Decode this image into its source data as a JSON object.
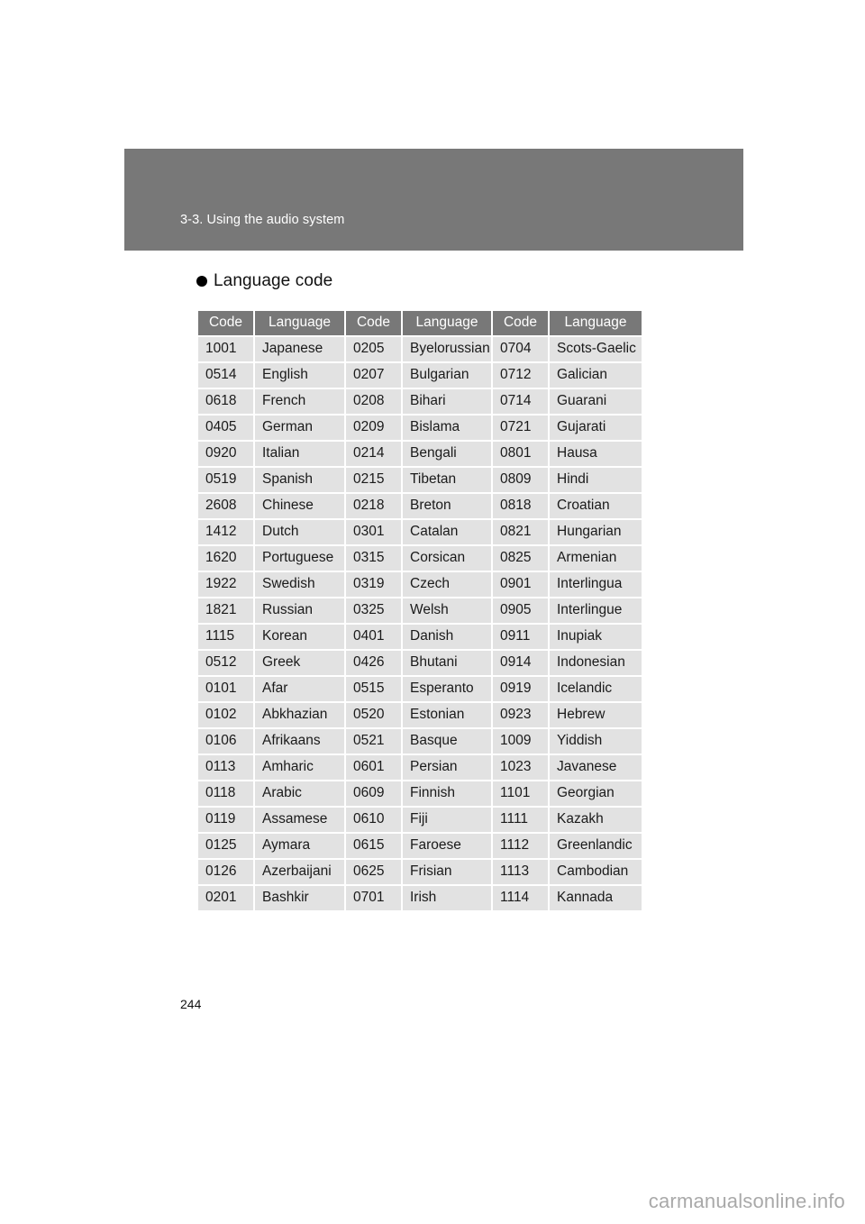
{
  "section": {
    "band_title": "3-3. Using the audio system"
  },
  "subsection": {
    "label": "Language code",
    "bullet_icon": "filled-circle-bullet-icon"
  },
  "table": {
    "headers": [
      "Code",
      "Language",
      "Code",
      "Language",
      "Code",
      "Language"
    ],
    "rows": [
      [
        "1001",
        "Japanese",
        "0205",
        "Byelorussian",
        "0704",
        "Scots-Gaelic"
      ],
      [
        "0514",
        "English",
        "0207",
        "Bulgarian",
        "0712",
        "Galician"
      ],
      [
        "0618",
        "French",
        "0208",
        "Bihari",
        "0714",
        "Guarani"
      ],
      [
        "0405",
        "German",
        "0209",
        "Bislama",
        "0721",
        "Gujarati"
      ],
      [
        "0920",
        "Italian",
        "0214",
        "Bengali",
        "0801",
        "Hausa"
      ],
      [
        "0519",
        "Spanish",
        "0215",
        "Tibetan",
        "0809",
        "Hindi"
      ],
      [
        "2608",
        "Chinese",
        "0218",
        "Breton",
        "0818",
        "Croatian"
      ],
      [
        "1412",
        "Dutch",
        "0301",
        "Catalan",
        "0821",
        "Hungarian"
      ],
      [
        "1620",
        "Portuguese",
        "0315",
        "Corsican",
        "0825",
        "Armenian"
      ],
      [
        "1922",
        "Swedish",
        "0319",
        "Czech",
        "0901",
        "Interlingua"
      ],
      [
        "1821",
        "Russian",
        "0325",
        "Welsh",
        "0905",
        "Interlingue"
      ],
      [
        "1115",
        "Korean",
        "0401",
        "Danish",
        "0911",
        "Inupiak"
      ],
      [
        "0512",
        "Greek",
        "0426",
        "Bhutani",
        "0914",
        "Indonesian"
      ],
      [
        "0101",
        "Afar",
        "0515",
        "Esperanto",
        "0919",
        "Icelandic"
      ],
      [
        "0102",
        "Abkhazian",
        "0520",
        "Estonian",
        "0923",
        "Hebrew"
      ],
      [
        "0106",
        "Afrikaans",
        "0521",
        "Basque",
        "1009",
        "Yiddish"
      ],
      [
        "0113",
        "Amharic",
        "0601",
        "Persian",
        "1023",
        "Javanese"
      ],
      [
        "0118",
        "Arabic",
        "0609",
        "Finnish",
        "1101",
        "Georgian"
      ],
      [
        "0119",
        "Assamese",
        "0610",
        "Fiji",
        "1111",
        "Kazakh"
      ],
      [
        "0125",
        "Aymara",
        "0615",
        "Faroese",
        "1112",
        "Greenlandic"
      ],
      [
        "0126",
        "Azerbaijani",
        "0625",
        "Frisian",
        "1113",
        "Cambodian"
      ],
      [
        "0201",
        "Bashkir",
        "0701",
        "Irish",
        "1114",
        "Kannada"
      ]
    ]
  },
  "footer": {
    "page_number": "244",
    "watermark": "carmanualsonline.info"
  },
  "colors": {
    "band_gray": "#787878",
    "header_gray": "#787878",
    "cell_gray": "#e2e2e2",
    "page_white": "#ffffff",
    "watermark_gray": "#a9a9a9"
  }
}
